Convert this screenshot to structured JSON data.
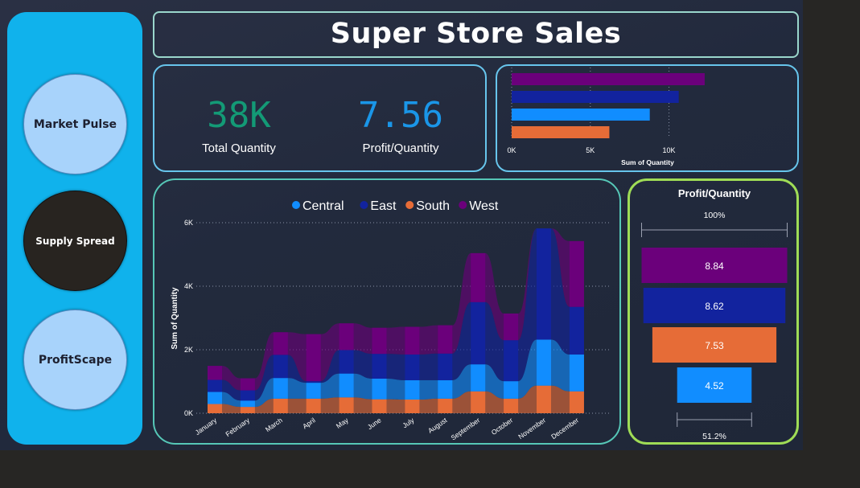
{
  "title": "Super Store Sales",
  "nav": [
    {
      "label": "Market Pulse",
      "state": "light"
    },
    {
      "label": "Supply Spread",
      "state": "dark"
    },
    {
      "label": "ProfitScape",
      "state": "light"
    }
  ],
  "kpis": [
    {
      "value": "38K",
      "label": "Total Quantity",
      "color": "#139a76"
    },
    {
      "value": "7.56",
      "label": "Profit/Quantity",
      "color": "#1a96e8"
    }
  ],
  "colors": {
    "Central": "#118dff",
    "East": "#12239e",
    "South": "#e66c37",
    "West": "#6b007b"
  },
  "chart_data": [
    {
      "type": "bar",
      "orientation": "horizontal",
      "categories": [
        "West",
        "East",
        "Central",
        "South"
      ],
      "values": [
        12270,
        10620,
        8780,
        6210
      ],
      "xlabel": "Sum of Quantity",
      "ticks": [
        "0K",
        "5K",
        "10K"
      ],
      "xlim": [
        0,
        13500
      ]
    },
    {
      "type": "area",
      "stacked": true,
      "categories": [
        "January",
        "February",
        "March",
        "April",
        "May",
        "June",
        "July",
        "August",
        "September",
        "October",
        "November",
        "December"
      ],
      "series": [
        {
          "name": "South",
          "values": [
            290,
            200,
            460,
            460,
            500,
            440,
            430,
            460,
            690,
            460,
            870,
            690
          ]
        },
        {
          "name": "Central",
          "values": [
            380,
            200,
            650,
            500,
            750,
            650,
            610,
            580,
            850,
            550,
            1450,
            1160
          ]
        },
        {
          "name": "East",
          "values": [
            380,
            320,
            730,
            50,
            740,
            780,
            810,
            840,
            1960,
            1290,
            3500,
            1500
          ]
        },
        {
          "name": "West",
          "values": [
            440,
            380,
            710,
            1480,
            840,
            820,
            870,
            890,
            1540,
            840,
            0,
            2070
          ]
        }
      ],
      "ylabel": "Sum of Quantity",
      "yticks": [
        "0K",
        "2K",
        "4K",
        "6K"
      ],
      "ylim": [
        0,
        6000
      ],
      "legend": "top"
    },
    {
      "type": "funnel",
      "title": "Profit/Quantity",
      "categories": [
        "West",
        "East",
        "South",
        "Central"
      ],
      "values": [
        8.84,
        8.62,
        7.53,
        4.52
      ],
      "labels": [
        "8.84",
        "8.62",
        "7.53",
        "4.52"
      ],
      "top_pct": "100%",
      "bottom_pct": "51.2%"
    }
  ]
}
